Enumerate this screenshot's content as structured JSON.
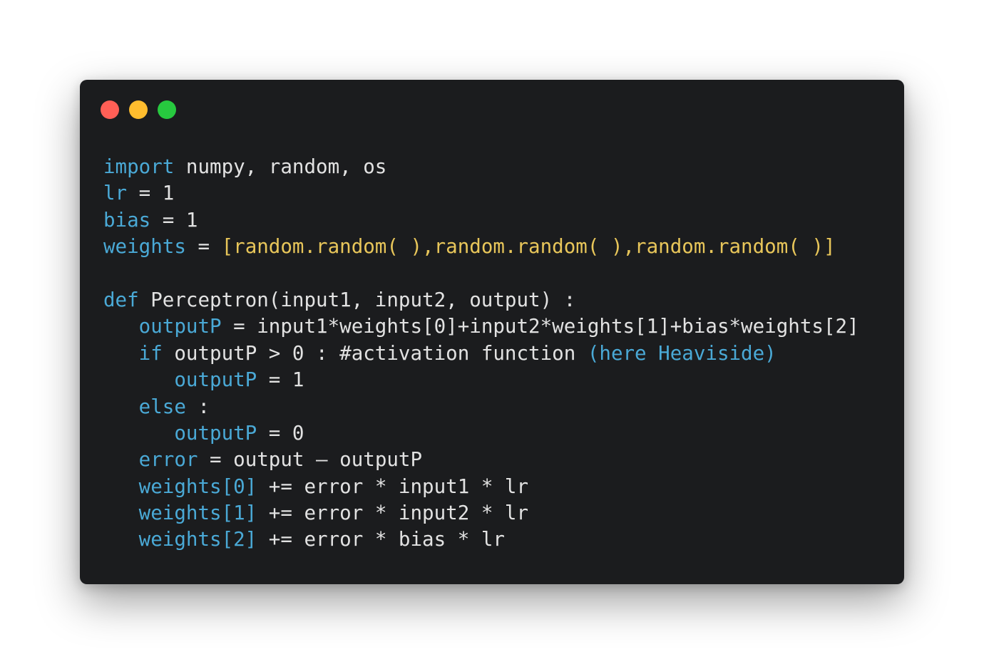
{
  "window": {
    "controls": [
      {
        "name": "close-button",
        "color": "#ff5f56"
      },
      {
        "name": "minimize-button",
        "color": "#ffbd2e"
      },
      {
        "name": "maximize-button",
        "color": "#27c93f"
      }
    ]
  },
  "colors": {
    "keyword": "#4aa9d6",
    "plain": "#e2e2e2",
    "string": "#e8c65a"
  },
  "code": {
    "lines": [
      [
        {
          "t": "import",
          "c": "keyword"
        },
        {
          "t": " numpy, random, os",
          "c": "plain"
        }
      ],
      [
        {
          "t": "lr",
          "c": "keyword"
        },
        {
          "t": " = 1",
          "c": "plain"
        }
      ],
      [
        {
          "t": "bias",
          "c": "keyword"
        },
        {
          "t": " = 1",
          "c": "plain"
        }
      ],
      [
        {
          "t": "weights",
          "c": "keyword"
        },
        {
          "t": " = ",
          "c": "plain"
        },
        {
          "t": "[random.random( ),random.random( ),random.random( )]",
          "c": "string"
        }
      ],
      [],
      [
        {
          "t": "def",
          "c": "keyword"
        },
        {
          "t": " Perceptron(input1, input2, output) :",
          "c": "plain"
        }
      ],
      [
        {
          "t": "   ",
          "c": "plain"
        },
        {
          "t": "outputP",
          "c": "keyword"
        },
        {
          "t": " = input1*weights[0]+input2*weights[1]+bias*weights[2]",
          "c": "plain"
        }
      ],
      [
        {
          "t": "   ",
          "c": "plain"
        },
        {
          "t": "if",
          "c": "keyword"
        },
        {
          "t": " outputP > 0 : #activation function ",
          "c": "plain"
        },
        {
          "t": "(here Heaviside)",
          "c": "keyword"
        }
      ],
      [
        {
          "t": "      ",
          "c": "plain"
        },
        {
          "t": "outputP",
          "c": "keyword"
        },
        {
          "t": " = 1",
          "c": "plain"
        }
      ],
      [
        {
          "t": "   ",
          "c": "plain"
        },
        {
          "t": "else",
          "c": "keyword"
        },
        {
          "t": " :",
          "c": "plain"
        }
      ],
      [
        {
          "t": "      ",
          "c": "plain"
        },
        {
          "t": "outputP",
          "c": "keyword"
        },
        {
          "t": " = 0",
          "c": "plain"
        }
      ],
      [
        {
          "t": "   ",
          "c": "plain"
        },
        {
          "t": "error",
          "c": "keyword"
        },
        {
          "t": " = output – outputP",
          "c": "plain"
        }
      ],
      [
        {
          "t": "   ",
          "c": "plain"
        },
        {
          "t": "weights[0]",
          "c": "keyword"
        },
        {
          "t": " += error * input1 * lr",
          "c": "plain"
        }
      ],
      [
        {
          "t": "   ",
          "c": "plain"
        },
        {
          "t": "weights[1]",
          "c": "keyword"
        },
        {
          "t": " += error * input2 * lr",
          "c": "plain"
        }
      ],
      [
        {
          "t": "   ",
          "c": "plain"
        },
        {
          "t": "weights[2]",
          "c": "keyword"
        },
        {
          "t": " += error * bias * lr",
          "c": "plain"
        }
      ]
    ]
  }
}
